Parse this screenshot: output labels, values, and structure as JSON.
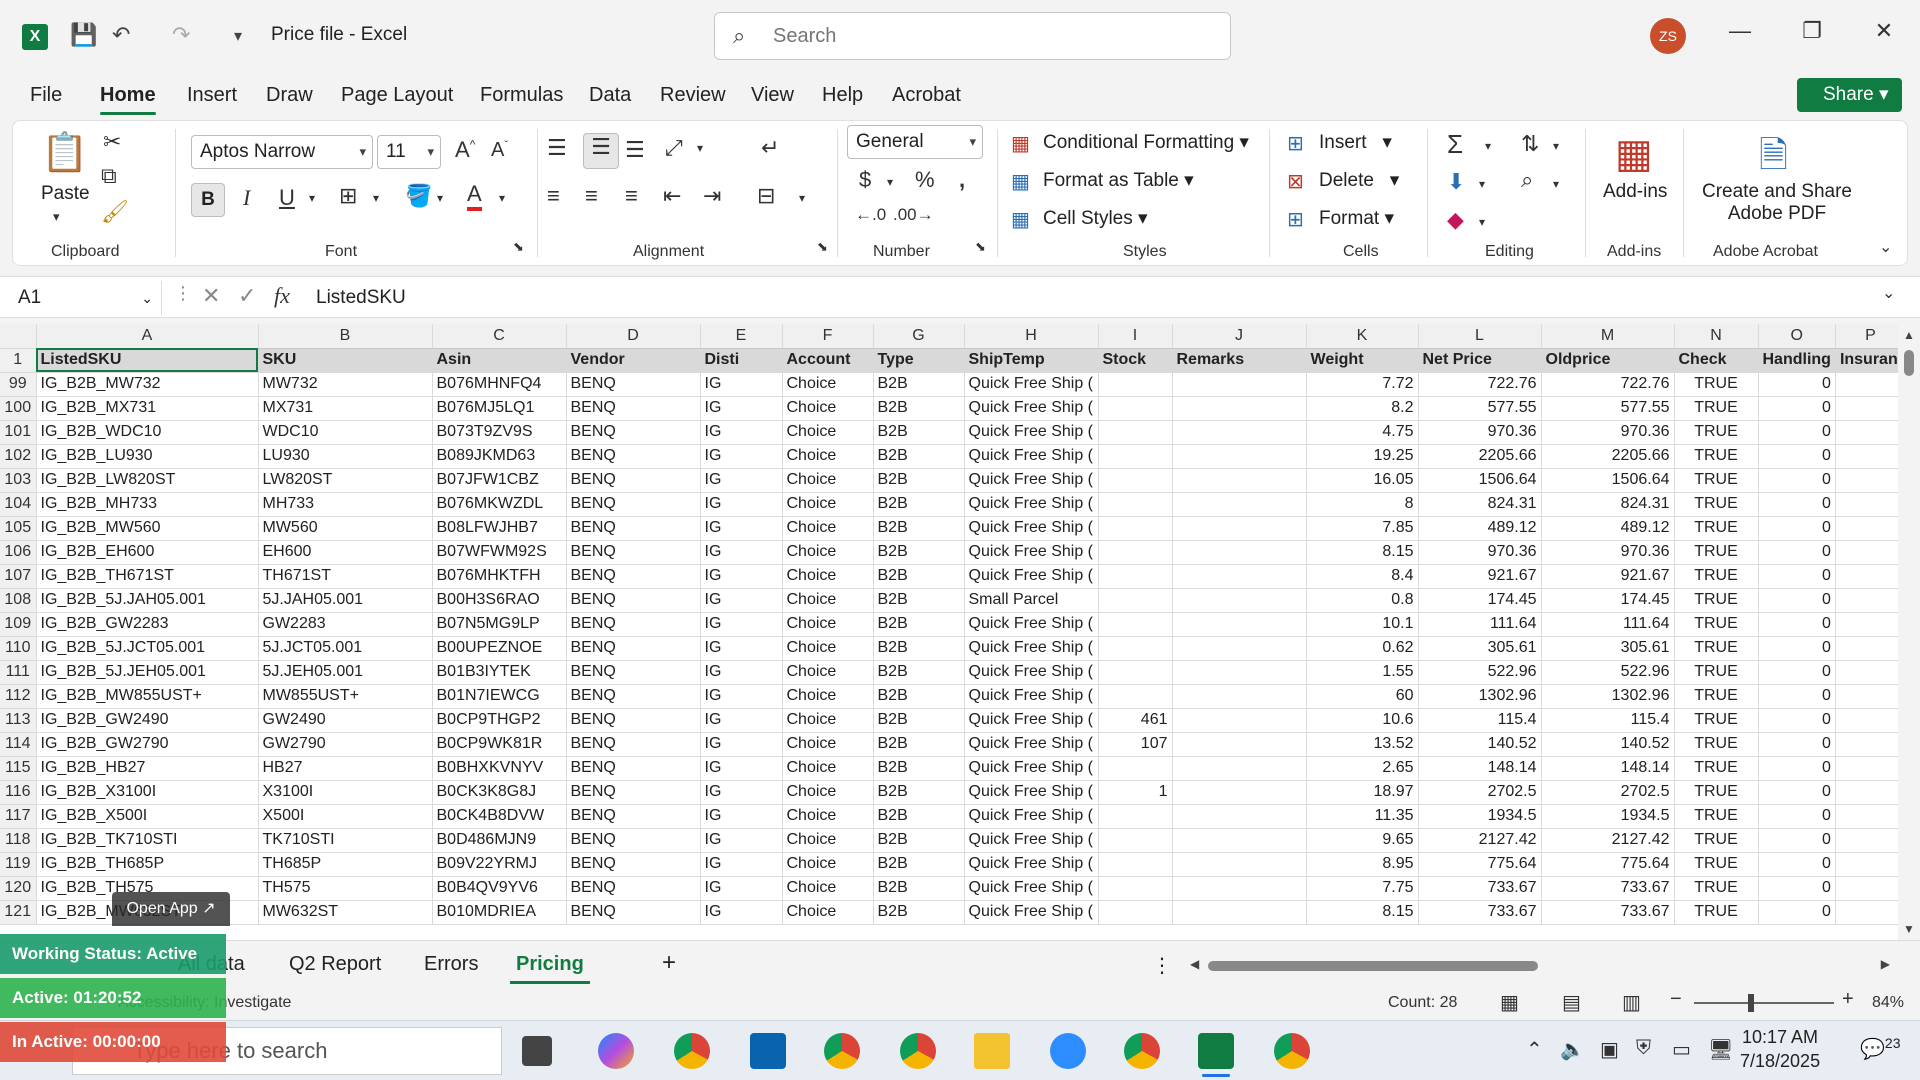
{
  "titlebar": {
    "doc_title": "Price file  -  Excel",
    "search_placeholder": "Search",
    "avatar_initials": "ZS"
  },
  "menu": [
    "File",
    "Home",
    "Insert",
    "Draw",
    "Page Layout",
    "Formulas",
    "Data",
    "Review",
    "View",
    "Help",
    "Acrobat"
  ],
  "active_menu": "Home",
  "share_label": "Share",
  "ribbon": {
    "clipboard": {
      "paste": "Paste",
      "label": "Clipboard"
    },
    "font": {
      "name": "Aptos Narrow",
      "size": "11",
      "label": "Font"
    },
    "alignment": {
      "label": "Alignment"
    },
    "number": {
      "format": "General",
      "label": "Number"
    },
    "styles": {
      "conditional": "Conditional Formatting",
      "format_table": "Format as Table",
      "cell_styles": "Cell Styles",
      "label": "Styles"
    },
    "cells": {
      "insert": "Insert",
      "delete": "Delete",
      "format": "Format",
      "label": "Cells"
    },
    "editing": {
      "label": "Editing"
    },
    "addins": {
      "btn": "Add-ins",
      "label": "Add-ins"
    },
    "acrobat": {
      "btn_line1": "Create and Share",
      "btn_line2": "Adobe PDF",
      "label": "Adobe Acrobat"
    }
  },
  "formula_bar": {
    "name_box": "A1",
    "content": "ListedSKU"
  },
  "columns": [
    "A",
    "B",
    "C",
    "D",
    "E",
    "F",
    "G",
    "H",
    "I",
    "J",
    "K",
    "L",
    "M",
    "N",
    "O",
    "P"
  ],
  "header_row": {
    "num": "1",
    "cells": [
      "ListedSKU",
      "SKU",
      "Asin",
      "Vendor",
      "Disti",
      "Account",
      "Type",
      "ShipTemp",
      "Stock",
      "Remarks",
      "Weight",
      "Net Price",
      "Oldprice",
      "Check",
      "Handling",
      "Insuran"
    ]
  },
  "rows": [
    {
      "num": "99",
      "cells": [
        "IG_B2B_MW732",
        "MW732",
        "B076MHNFQ4",
        "BENQ",
        "IG",
        "Choice",
        "B2B",
        "Quick Free Ship (",
        "",
        "",
        "7.72",
        "722.76",
        "722.76",
        "TRUE",
        "0",
        ""
      ]
    },
    {
      "num": "100",
      "cells": [
        "IG_B2B_MX731",
        "MX731",
        "B076MJ5LQ1",
        "BENQ",
        "IG",
        "Choice",
        "B2B",
        "Quick Free Ship (",
        "",
        "",
        "8.2",
        "577.55",
        "577.55",
        "TRUE",
        "0",
        ""
      ]
    },
    {
      "num": "101",
      "cells": [
        "IG_B2B_WDC10",
        "WDC10",
        "B073T9ZV9S",
        "BENQ",
        "IG",
        "Choice",
        "B2B",
        "Quick Free Ship (",
        "",
        "",
        "4.75",
        "970.36",
        "970.36",
        "TRUE",
        "0",
        ""
      ]
    },
    {
      "num": "102",
      "cells": [
        "IG_B2B_LU930",
        "LU930",
        "B089JKMD63",
        "BENQ",
        "IG",
        "Choice",
        "B2B",
        "Quick Free Ship (",
        "",
        "",
        "19.25",
        "2205.66",
        "2205.66",
        "TRUE",
        "0",
        ""
      ]
    },
    {
      "num": "103",
      "cells": [
        "IG_B2B_LW820ST",
        "LW820ST",
        "B07JFW1CBZ",
        "BENQ",
        "IG",
        "Choice",
        "B2B",
        "Quick Free Ship (",
        "",
        "",
        "16.05",
        "1506.64",
        "1506.64",
        "TRUE",
        "0",
        ""
      ]
    },
    {
      "num": "104",
      "cells": [
        "IG_B2B_MH733",
        "MH733",
        "B076MKWZDL",
        "BENQ",
        "IG",
        "Choice",
        "B2B",
        "Quick Free Ship (",
        "",
        "",
        "8",
        "824.31",
        "824.31",
        "TRUE",
        "0",
        ""
      ]
    },
    {
      "num": "105",
      "cells": [
        "IG_B2B_MW560",
        "MW560",
        "B08LFWJHB7",
        "BENQ",
        "IG",
        "Choice",
        "B2B",
        "Quick Free Ship (",
        "",
        "",
        "7.85",
        "489.12",
        "489.12",
        "TRUE",
        "0",
        ""
      ]
    },
    {
      "num": "106",
      "cells": [
        "IG_B2B_EH600",
        "EH600",
        "B07WFWM92S",
        "BENQ",
        "IG",
        "Choice",
        "B2B",
        "Quick Free Ship (",
        "",
        "",
        "8.15",
        "970.36",
        "970.36",
        "TRUE",
        "0",
        ""
      ]
    },
    {
      "num": "107",
      "cells": [
        "IG_B2B_TH671ST",
        "TH671ST",
        "B076MHKTFH",
        "BENQ",
        "IG",
        "Choice",
        "B2B",
        "Quick Free Ship (",
        "",
        "",
        "8.4",
        "921.67",
        "921.67",
        "TRUE",
        "0",
        ""
      ]
    },
    {
      "num": "108",
      "cells": [
        "IG_B2B_5J.JAH05.001",
        "5J.JAH05.001",
        "B00H3S6RAO",
        "BENQ",
        "IG",
        "Choice",
        "B2B",
        "Small Parcel",
        "",
        "",
        "0.8",
        "174.45",
        "174.45",
        "TRUE",
        "0",
        ""
      ]
    },
    {
      "num": "109",
      "cells": [
        "IG_B2B_GW2283",
        "GW2283",
        "B07N5MG9LP",
        "BENQ",
        "IG",
        "Choice",
        "B2B",
        "Quick Free Ship (",
        "",
        "",
        "10.1",
        "111.64",
        "111.64",
        "TRUE",
        "0",
        ""
      ]
    },
    {
      "num": "110",
      "cells": [
        "IG_B2B_5J.JCT05.001",
        "5J.JCT05.001",
        "B00UPEZNOE",
        "BENQ",
        "IG",
        "Choice",
        "B2B",
        "Quick Free Ship (",
        "",
        "",
        "0.62",
        "305.61",
        "305.61",
        "TRUE",
        "0",
        ""
      ]
    },
    {
      "num": "111",
      "cells": [
        "IG_B2B_5J.JEH05.001",
        "5J.JEH05.001",
        "B01B3IYTEK",
        "BENQ",
        "IG",
        "Choice",
        "B2B",
        "Quick Free Ship (",
        "",
        "",
        "1.55",
        "522.96",
        "522.96",
        "TRUE",
        "0",
        ""
      ]
    },
    {
      "num": "112",
      "cells": [
        "IG_B2B_MW855UST+",
        "MW855UST+",
        "B01N7IEWCG",
        "BENQ",
        "IG",
        "Choice",
        "B2B",
        "Quick Free Ship (",
        "",
        "",
        "60",
        "1302.96",
        "1302.96",
        "TRUE",
        "0",
        ""
      ]
    },
    {
      "num": "113",
      "cells": [
        "IG_B2B_GW2490",
        "GW2490",
        "B0CP9THGP2",
        "BENQ",
        "IG",
        "Choice",
        "B2B",
        "Quick Free Ship (",
        "461",
        "",
        "10.6",
        "115.4",
        "115.4",
        "TRUE",
        "0",
        ""
      ]
    },
    {
      "num": "114",
      "cells": [
        "IG_B2B_GW2790",
        "GW2790",
        "B0CP9WK81R",
        "BENQ",
        "IG",
        "Choice",
        "B2B",
        "Quick Free Ship (",
        "107",
        "",
        "13.52",
        "140.52",
        "140.52",
        "TRUE",
        "0",
        ""
      ]
    },
    {
      "num": "115",
      "cells": [
        "IG_B2B_HB27",
        "HB27",
        "B0BHXKVNYV",
        "BENQ",
        "IG",
        "Choice",
        "B2B",
        "Quick Free Ship (",
        "",
        "",
        "2.65",
        "148.14",
        "148.14",
        "TRUE",
        "0",
        ""
      ]
    },
    {
      "num": "116",
      "cells": [
        "IG_B2B_X3100I",
        "X3100I",
        "B0CK3K8G8J",
        "BENQ",
        "IG",
        "Choice",
        "B2B",
        "Quick Free Ship (",
        "1",
        "",
        "18.97",
        "2702.5",
        "2702.5",
        "TRUE",
        "0",
        ""
      ]
    },
    {
      "num": "117",
      "cells": [
        "IG_B2B_X500I",
        "X500I",
        "B0CK4B8DVW",
        "BENQ",
        "IG",
        "Choice",
        "B2B",
        "Quick Free Ship (",
        "",
        "",
        "11.35",
        "1934.5",
        "1934.5",
        "TRUE",
        "0",
        ""
      ]
    },
    {
      "num": "118",
      "cells": [
        "IG_B2B_TK710STI",
        "TK710STI",
        "B0D486MJN9",
        "BENQ",
        "IG",
        "Choice",
        "B2B",
        "Quick Free Ship (",
        "",
        "",
        "9.65",
        "2127.42",
        "2127.42",
        "TRUE",
        "0",
        ""
      ]
    },
    {
      "num": "119",
      "cells": [
        "IG_B2B_TH685P",
        "TH685P",
        "B09V22YRMJ",
        "BENQ",
        "IG",
        "Choice",
        "B2B",
        "Quick Free Ship (",
        "",
        "",
        "8.95",
        "775.64",
        "775.64",
        "TRUE",
        "0",
        ""
      ]
    },
    {
      "num": "120",
      "cells": [
        "IG_B2B_TH575",
        "TH575",
        "B0B4QV9YV6",
        "BENQ",
        "IG",
        "Choice",
        "B2B",
        "Quick Free Ship (",
        "",
        "",
        "7.75",
        "733.67",
        "733.67",
        "TRUE",
        "0",
        ""
      ]
    },
    {
      "num": "121",
      "cells": [
        "IG_B2B_MW632ST",
        "MW632ST",
        "B010MDRIEA",
        "BENQ",
        "IG",
        "Choice",
        "B2B",
        "Quick Free Ship (",
        "",
        "",
        "8.15",
        "733.67",
        "733.67",
        "TRUE",
        "0",
        ""
      ]
    }
  ],
  "sheets": [
    "All data",
    "Q2 Report",
    "Errors",
    "Pricing"
  ],
  "active_sheet": "Pricing",
  "status": {
    "accessibility": "Accessibility: Investigate",
    "count": "Count: 28",
    "zoom": "84%"
  },
  "taskbar": {
    "search_placeholder": "Type here to search",
    "time": "10:17 AM",
    "date": "7/18/2025",
    "notif": "23"
  },
  "overlay": {
    "open_app": "Open App ↗",
    "working": "Working Status: Active",
    "active": "Active: 01:20:52",
    "inactive": "In Active: 00:00:00"
  },
  "colors": {
    "accent": "#107c41",
    "header_fill": "#d9d9d9"
  }
}
